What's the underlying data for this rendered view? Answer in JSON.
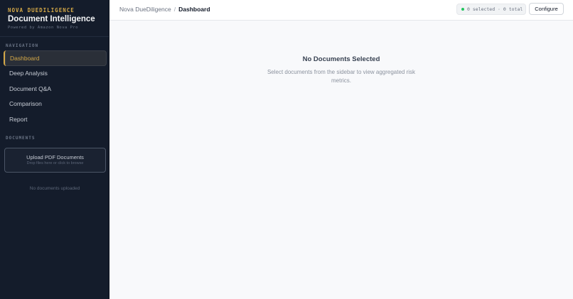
{
  "brand": {
    "kicker": "NOVA DUEDILIGENCE",
    "title": "Document Intelligence",
    "subtitle": "Powered by Amazon Nova Pro"
  },
  "sidebar": {
    "nav_label": "NAVIGATION",
    "nav_items": [
      {
        "label": "Dashboard",
        "active": true
      },
      {
        "label": "Deep Analysis",
        "active": false
      },
      {
        "label": "Document Q&A",
        "active": false
      },
      {
        "label": "Comparison",
        "active": false
      },
      {
        "label": "Report",
        "active": false
      }
    ],
    "documents_label": "DOCUMENTS",
    "upload": {
      "title": "Upload PDF Documents",
      "hint": "Drop files here or click to browse"
    },
    "empty_text": "No documents uploaded"
  },
  "header": {
    "breadcrumb_root": "Nova DueDiligence",
    "breadcrumb_sep": "/",
    "breadcrumb_current": "Dashboard",
    "status_text": "0 selected · 0 total",
    "configure_label": "Configure"
  },
  "main": {
    "empty_title": "No Documents Selected",
    "empty_text": "Select documents from the sidebar to view aggregated risk metrics."
  },
  "colors": {
    "accent": "#d4a847",
    "sidebar_bg": "#141c2b",
    "status_dot": "#22c55e"
  }
}
